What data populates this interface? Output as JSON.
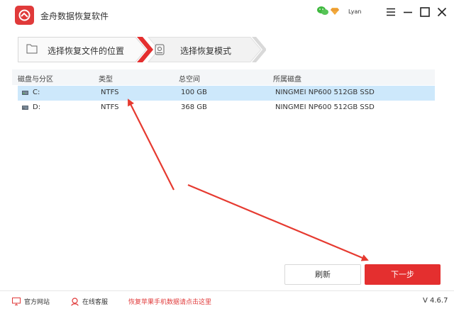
{
  "app": {
    "title": "金舟数据恢复软件",
    "user_name": "Lyan",
    "accent_color": "#e42f2f"
  },
  "steps": [
    {
      "label": "选择恢复文件的位置",
      "active": true
    },
    {
      "label": "选择恢复模式",
      "active": false
    }
  ],
  "table": {
    "headers": [
      "磁盘与分区",
      "类型",
      "总空间",
      "所属磁盘"
    ],
    "rows": [
      {
        "name": "C:",
        "type": "NTFS",
        "size": "100 GB",
        "disk": "NINGMEI NP600 512GB SSD",
        "selected": true
      },
      {
        "name": "D:",
        "type": "NTFS",
        "size": "368 GB",
        "disk": "NINGMEI NP600 512GB SSD",
        "selected": false
      }
    ]
  },
  "buttons": {
    "refresh": "刷新",
    "next": "下一步"
  },
  "footer": {
    "website": "官方网站",
    "support": "在线客服",
    "promo": "恢复苹果手机数据请点击这里",
    "version": "V 4.6.7"
  },
  "icons": [
    "app-logo-icon",
    "wechat-icon",
    "vip-diamond-icon",
    "menu-icon",
    "minimize-icon",
    "maximize-icon",
    "close-icon",
    "folder-icon",
    "disk-mode-icon",
    "drive-icon",
    "monitor-icon",
    "headset-icon"
  ]
}
